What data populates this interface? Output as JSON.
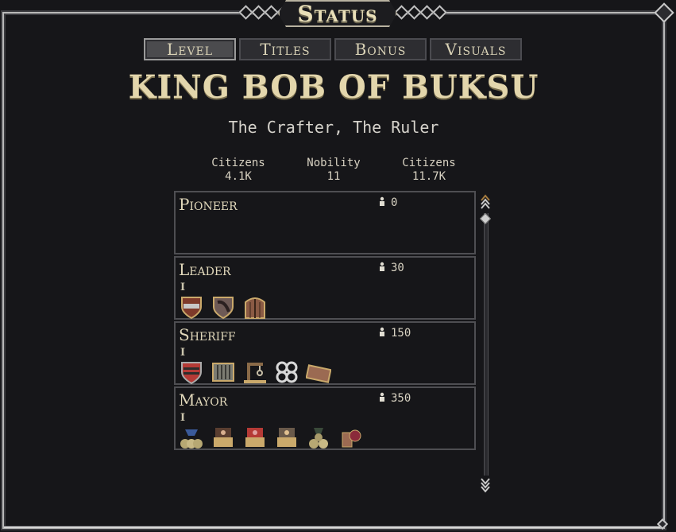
{
  "window": {
    "title": "Status"
  },
  "tabs": [
    {
      "label": "Level",
      "active": true
    },
    {
      "label": "Titles",
      "active": false
    },
    {
      "label": "Bonus",
      "active": false
    },
    {
      "label": "Visuals",
      "active": false
    }
  ],
  "ruler": {
    "name": "KING BOB OF BUKSU",
    "epithet": "The Crafter, The Ruler"
  },
  "stats": [
    {
      "label": "Citizens",
      "value": "4.1K"
    },
    {
      "label": "Nobility",
      "value": "11"
    },
    {
      "label": "Citizens",
      "value": "11.7K"
    }
  ],
  "ranks": [
    {
      "title": "Pioneer",
      "requirement": "0",
      "tier": "",
      "icons": []
    },
    {
      "title": "Leader",
      "requirement": "30",
      "tier": "I",
      "icons": [
        "shield-banner-icon",
        "horn-icon",
        "wooden-door-icon"
      ]
    },
    {
      "title": "Sheriff",
      "requirement": "150",
      "tier": "I",
      "icons": [
        "red-striped-shield-icon",
        "cage-icon",
        "gallows-icon",
        "shackles-icon",
        "wanted-sign-icon"
      ]
    },
    {
      "title": "Mayor",
      "requirement": "350",
      "tier": "I",
      "icons": [
        "coin-sacks-icon",
        "stall-icon",
        "red-stall-icon",
        "market-stall-icon",
        "coin-bags-icon",
        "pottery-icon"
      ]
    }
  ],
  "colors": {
    "background": "#161619",
    "gold_text": "#e3d6ac",
    "border": "#4e4e52"
  }
}
